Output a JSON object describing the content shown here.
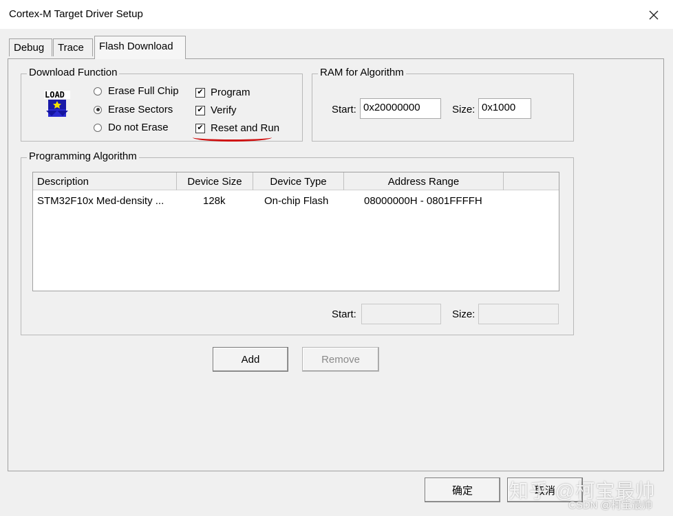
{
  "window": {
    "title": "Cortex-M Target Driver Setup"
  },
  "tabs": [
    {
      "label": "Debug"
    },
    {
      "label": "Trace"
    },
    {
      "label": "Flash Download",
      "active": true
    }
  ],
  "download_function": {
    "legend": "Download Function",
    "icon_text": "LOAD",
    "radios": [
      {
        "label": "Erase Full Chip",
        "checked": false
      },
      {
        "label": "Erase Sectors",
        "checked": true
      },
      {
        "label": "Do not Erase",
        "checked": false
      }
    ],
    "checkboxes": [
      {
        "label": "Program",
        "checked": true
      },
      {
        "label": "Verify",
        "checked": true
      },
      {
        "label": "Reset and Run",
        "checked": true
      }
    ]
  },
  "ram_for_algorithm": {
    "legend": "RAM for Algorithm",
    "start_label": "Start:",
    "start_value": "0x20000000",
    "size_label": "Size:",
    "size_value": "0x1000"
  },
  "programming_algorithm": {
    "legend": "Programming Algorithm",
    "columns": [
      "Description",
      "Device Size",
      "Device Type",
      "Address Range"
    ],
    "rows": [
      {
        "description": "STM32F10x Med-density ...",
        "device_size": "128k",
        "device_type": "On-chip Flash",
        "address_range": "08000000H - 0801FFFFH"
      }
    ],
    "start_label": "Start:",
    "start_value": "",
    "size_label": "Size:",
    "size_value": ""
  },
  "buttons": {
    "add": "Add",
    "remove": "Remove",
    "ok": "确定",
    "cancel": "取消"
  },
  "watermark": {
    "main": "知乎 @柯宝最帅",
    "sub": "CSDN @柯宝最帅"
  },
  "colors": {
    "annotation_red": "#d01010"
  }
}
